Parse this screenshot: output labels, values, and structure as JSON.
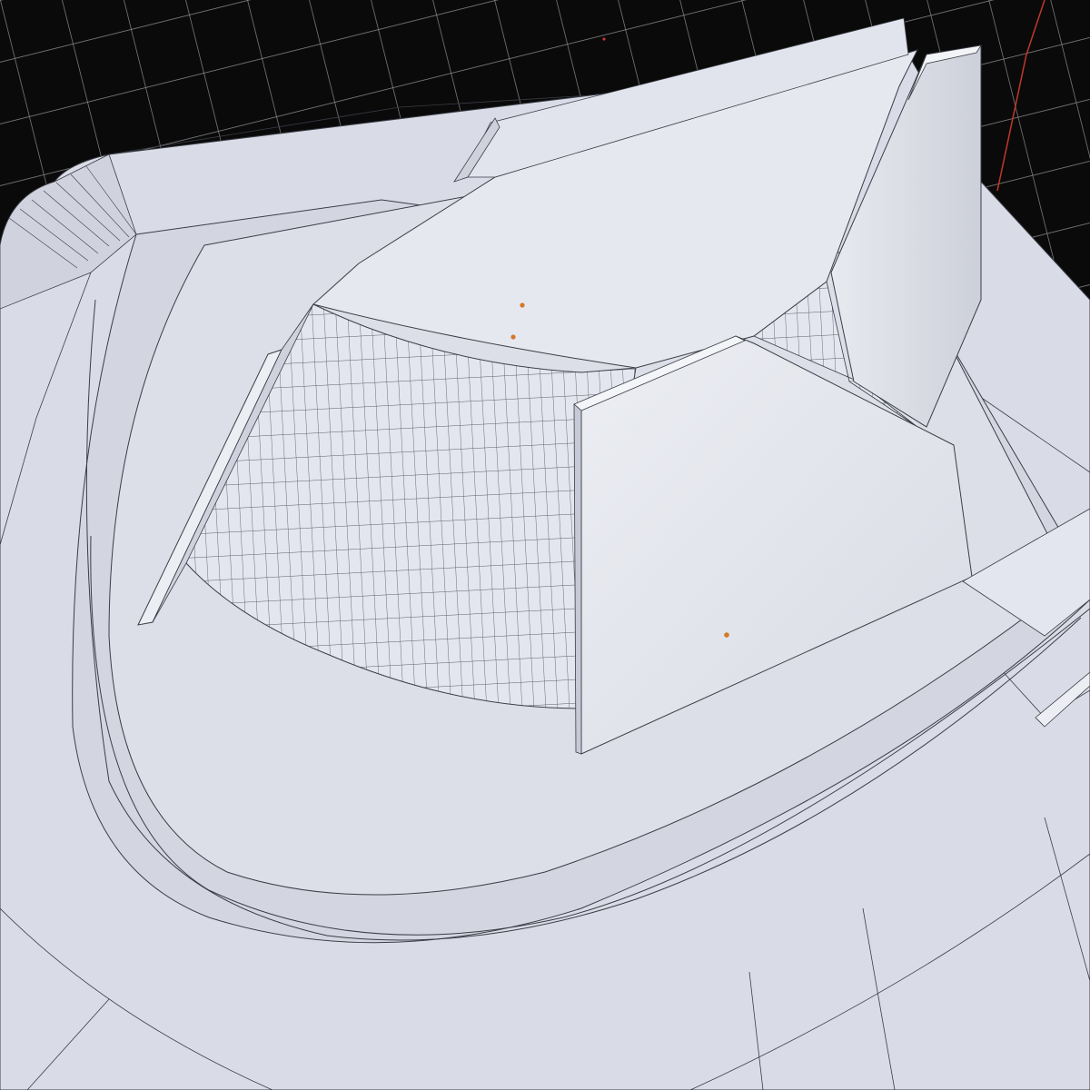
{
  "viewport": {
    "kind": "3d-modeling-viewport",
    "shading": "solid-with-wireframe",
    "background_color": "#0a0a0a",
    "grid_color": "#8a8a8a",
    "axis_color": "#c0392b"
  },
  "scene": {
    "model": "architectural-site-model",
    "surface_color": "#d9dce6",
    "surface_shadow_color": "#c7cad6",
    "roof_color": "#e6e8ef",
    "wall_light_color": "#eceef3",
    "wall_shade_color": "#cfd2dc",
    "edge_color": "#3a3d46",
    "origin_point_color": "#d4782a",
    "origin_point_count": 3
  }
}
